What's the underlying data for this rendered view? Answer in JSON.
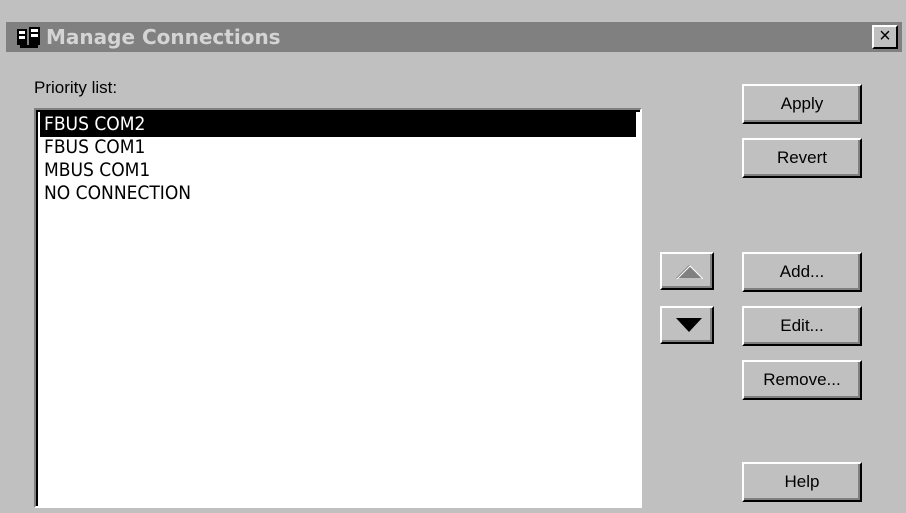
{
  "window": {
    "title": "Manage Connections",
    "close_label": "×"
  },
  "priority_label": "Priority list:",
  "priority_list": [
    {
      "label": "FBUS COM2",
      "selected": true
    },
    {
      "label": "FBUS COM1",
      "selected": false
    },
    {
      "label": "MBUS COM1",
      "selected": false
    },
    {
      "label": "NO CONNECTION",
      "selected": false
    }
  ],
  "buttons": {
    "apply": "Apply",
    "revert": "Revert",
    "add": "Add...",
    "edit": "Edit...",
    "remove": "Remove...",
    "help": "Help"
  },
  "arrows": {
    "up_icon": "arrow-up-icon",
    "up_enabled": false,
    "down_icon": "arrow-down-icon",
    "down_enabled": true
  },
  "colors": {
    "face": "#c0c0c0",
    "titlebar_inactive": "#808080",
    "selection": "#000000"
  }
}
